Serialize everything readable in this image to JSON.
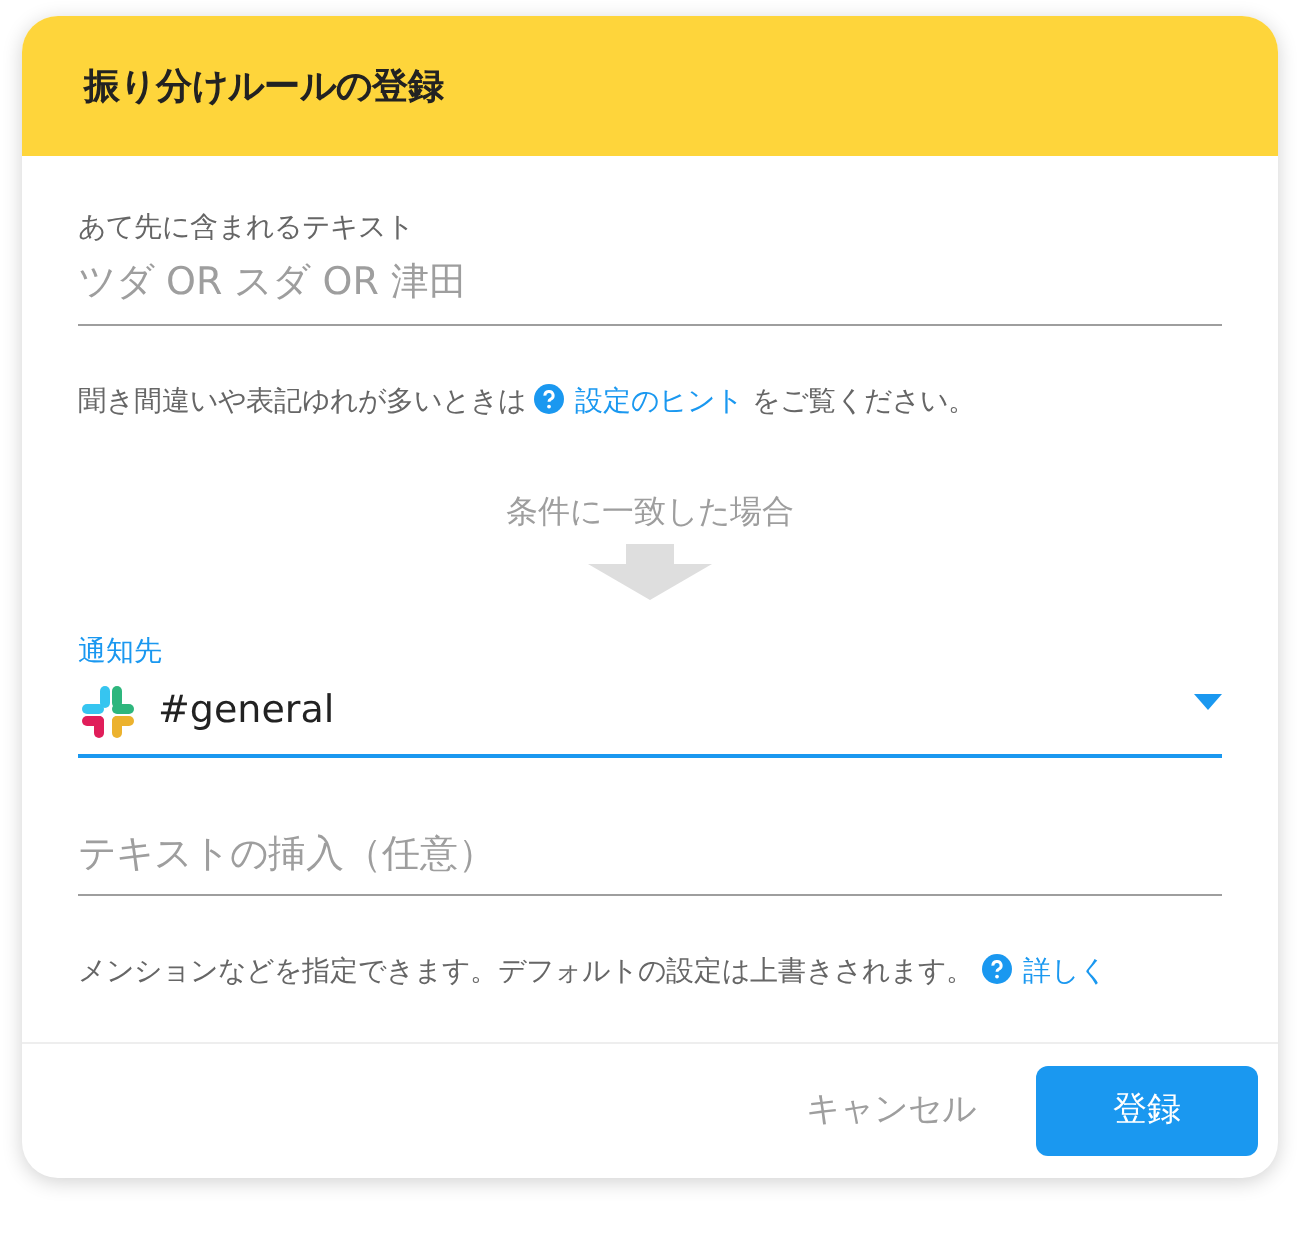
{
  "dialog": {
    "title": "振り分けルールの登録"
  },
  "fields": [
    {
      "kind": "text",
      "label": "あて先に含まれるテキスト",
      "placeholder": "ツダ OR スダ OR 津田",
      "focused": false
    },
    {
      "kind": "hint",
      "before": "聞き間違いや表記ゆれが多いときは",
      "link": "設定のヒント",
      "after": "をご覧ください。"
    },
    {
      "kind": "arrow",
      "caption": "条件に一致した場合"
    },
    {
      "kind": "select",
      "label": "通知先",
      "value": "#general",
      "focused": true
    },
    {
      "kind": "text",
      "placeholder": "テキストの挿入（任意）",
      "focused": false
    },
    {
      "kind": "hint",
      "before": "メンションなどを指定できます。デフォルトの設定は上書きされます。",
      "link": "詳しく"
    }
  ],
  "buttons": [
    {
      "label": "キャンセル",
      "primary": false
    },
    {
      "label": "登録",
      "primary": true
    }
  ]
}
